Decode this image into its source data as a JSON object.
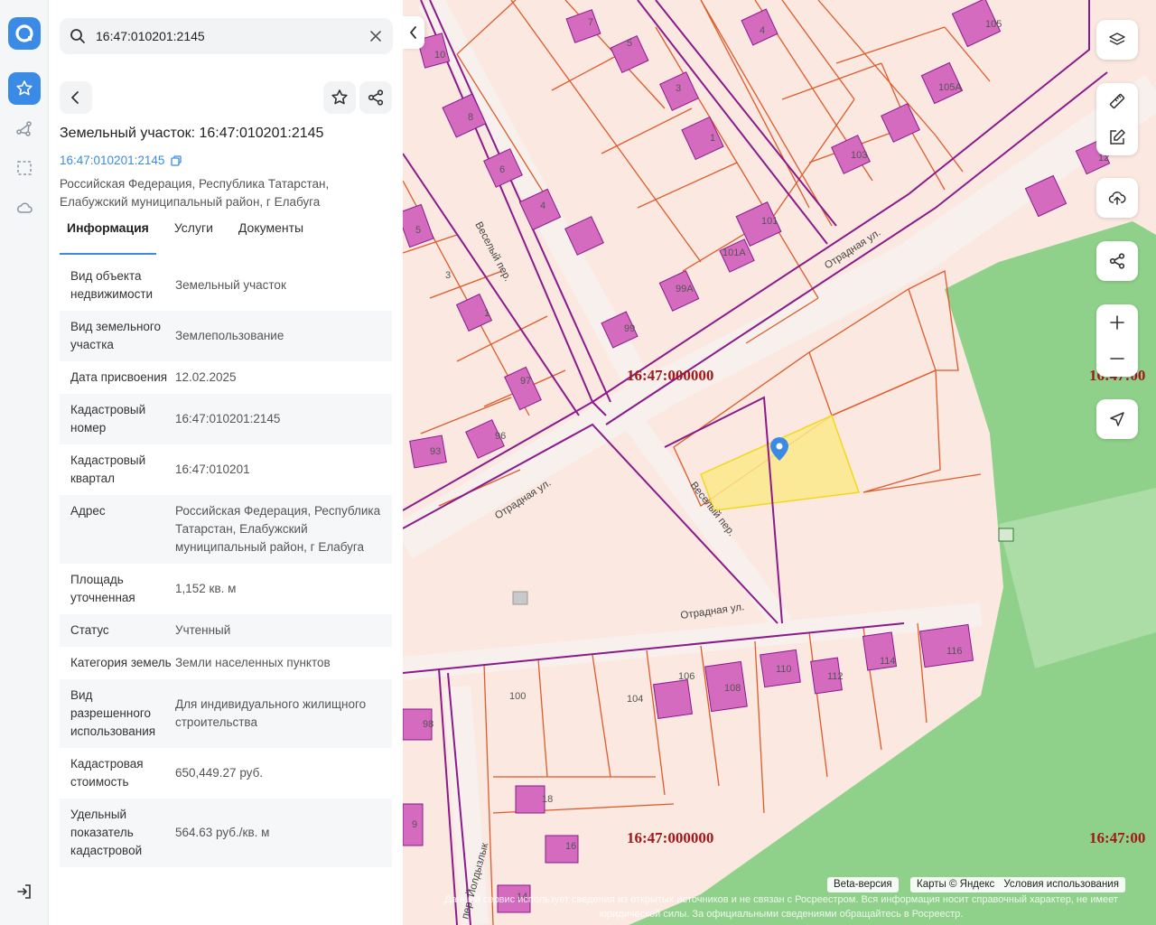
{
  "search": {
    "value": "16:47:010201:2145"
  },
  "object": {
    "title": "Земельный участок: 16:47:010201:2145",
    "cad_link": "16:47:010201:2145",
    "address": "Российская Федерация, Республика Татарстан, Елабужский муниципальный район, г Елабуга"
  },
  "tabs": [
    {
      "label": "Информация"
    },
    {
      "label": "Услуги"
    },
    {
      "label": "Документы"
    }
  ],
  "info": [
    {
      "k": "Вид объекта недвижимости",
      "v": "Земельный участок"
    },
    {
      "k": "Вид земельного участка",
      "v": "Землепользование"
    },
    {
      "k": "Дата присвоения",
      "v": "12.02.2025"
    },
    {
      "k": "Кадастровый номер",
      "v": "16:47:010201:2145"
    },
    {
      "k": "Кадастровый квартал",
      "v": "16:47:010201"
    },
    {
      "k": "Адрес",
      "v": "Российская Федерация, Республика Татарстан, Елабужский муниципальный район, г Елабуга"
    },
    {
      "k": "Площадь уточненная",
      "v": "1,152 кв. м"
    },
    {
      "k": "Статус",
      "v": "Учтенный"
    },
    {
      "k": "Категория земель",
      "v": "Земли населенных пунктов"
    },
    {
      "k": "Вид разрешенного использования",
      "v": "Для индивидуального жилищного строительства"
    },
    {
      "k": "Кадастровая стоимость",
      "v": "650,449.27 руб."
    },
    {
      "k": "Удельный показатель кадастровой",
      "v": "564.63 руб./кв. м"
    }
  ],
  "map": {
    "streets": [
      "Веселый пер.",
      "Отрадная ул.",
      "Отрадная ул.",
      "Отрадная ул.",
      "Веселый пер.",
      "пер. Йолдызлык"
    ],
    "quarters": [
      "16:47:000000",
      "16:47:000000",
      "16:47:00",
      "16:47:00"
    ],
    "houses": [
      "10",
      "7",
      "5",
      "4",
      "105",
      "8",
      "3",
      "1",
      "105А",
      "6",
      "4",
      "101",
      "103",
      "12",
      "5",
      "101А",
      "3",
      "99А",
      "1",
      "99",
      "97",
      "96",
      "93",
      "100",
      "106",
      "104",
      "108",
      "110",
      "112",
      "114",
      "116",
      "98",
      "18",
      "9",
      "16",
      "14"
    ],
    "beta": "Beta-версия",
    "copyright": "Карты © Яндекс",
    "terms": "Условия использования",
    "disclaimer": "Данный сервис использует сведения из открытых источников и не связан с Росреестром. Вся информация носит справочный характер, не имеет юридической силы. За официальными сведениями обращайтесь в Росреестр."
  },
  "colors": {
    "accent": "#3b8be6",
    "parcel_line": "#e05a2b",
    "boundary": "#8b1a8b",
    "building": "#d46bbf",
    "green": "#8fd18a",
    "selected": "#fbe98a"
  }
}
